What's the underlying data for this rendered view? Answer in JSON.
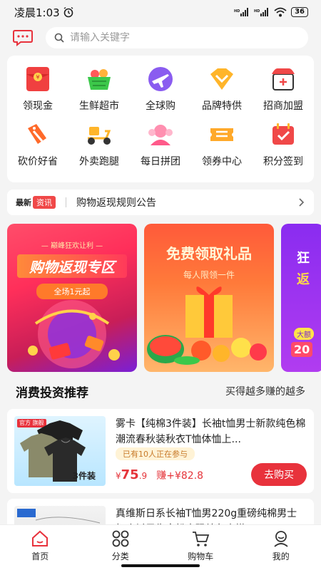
{
  "status": {
    "time": "凌晨1:03",
    "battery": "36"
  },
  "search": {
    "placeholder": "请输入关键字"
  },
  "categories": [
    {
      "label": "领现金",
      "icon": "red-envelope-icon"
    },
    {
      "label": "生鲜超市",
      "icon": "fruit-basket-icon"
    },
    {
      "label": "全球购",
      "icon": "airplane-icon"
    },
    {
      "label": "品牌特供",
      "icon": "brand-diamond-icon"
    },
    {
      "label": "招商加盟",
      "icon": "store-icon"
    },
    {
      "label": "砍价好省",
      "icon": "price-tag-icon"
    },
    {
      "label": "外卖跑腿",
      "icon": "scooter-icon"
    },
    {
      "label": "每日拼团",
      "icon": "group-avatar-icon"
    },
    {
      "label": "领券中心",
      "icon": "coupon-icon"
    },
    {
      "label": "积分签到",
      "icon": "calendar-check-icon"
    }
  ],
  "notice": {
    "tag_latest": "最新",
    "tag_news": "资讯",
    "text": "购物返现规则公告"
  },
  "banners": {
    "b1": {
      "top": "— 巅峰狂欢让利 —",
      "title": "购物返现专区",
      "pill": "全场1元起"
    },
    "b2": {
      "title": "免费领取礼品",
      "sub": "每人限领一件"
    },
    "b3": {
      "text1": "狂",
      "text2": "返",
      "pill": "大额",
      "num": "20"
    }
  },
  "section": {
    "title": "消费投资推荐",
    "subtitle": "买得越多赚的越多"
  },
  "products": [
    {
      "title": "雾卡【纯棉3件装】长袖t恤男士新款纯色棉潮流春秋装秋衣T恤体恤上...",
      "badge": "已有10人正在参与",
      "currency": "¥",
      "price": "75",
      "price_decimal": ".9",
      "earn": "赚+¥82.8",
      "button": "去购买",
      "img_tag": "官方\n旗舰",
      "img_count": "3件装"
    },
    {
      "title": "真维斯日系长袖T恤男220g重磅纯棉男士打底衫男生宽松大码纯色内搭"
    }
  ],
  "tabs": [
    {
      "label": "首页",
      "icon": "home-icon"
    },
    {
      "label": "分类",
      "icon": "grid-icon"
    },
    {
      "label": "购物车",
      "icon": "cart-icon"
    },
    {
      "label": "我的",
      "icon": "user-icon"
    }
  ],
  "colors": {
    "accent": "#e8323c",
    "background": "#f4f4f4"
  }
}
